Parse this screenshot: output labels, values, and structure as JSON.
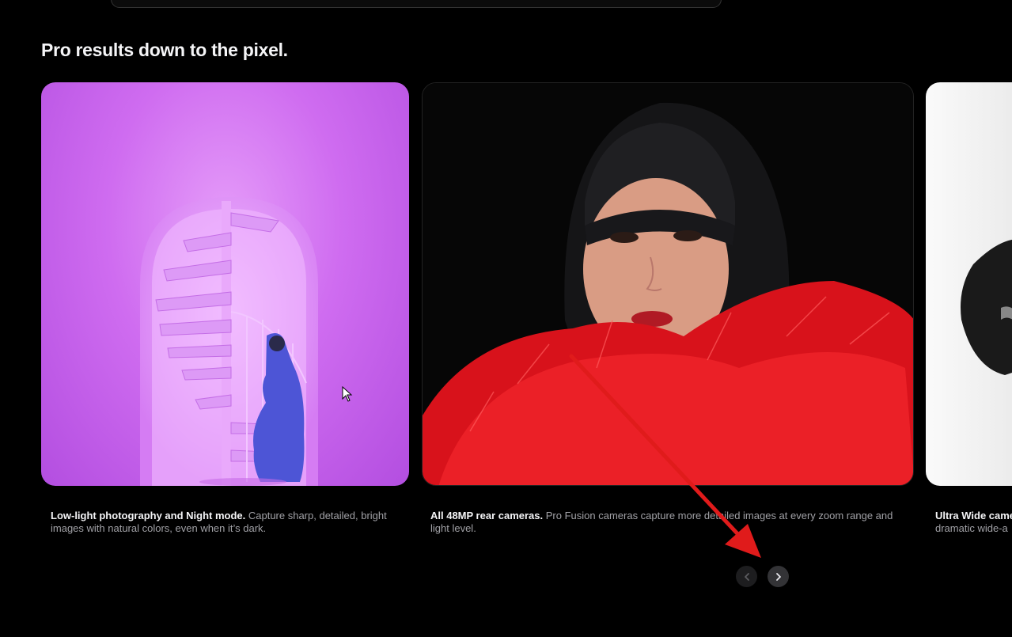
{
  "section": {
    "headline": "Pro results down to the pixel."
  },
  "cards": [
    {
      "title": "Low-light photography and Night mode.",
      "body": " Capture sharp, detailed, bright images with natural colors, even when it’s dark."
    },
    {
      "title": "All 48MP rear cameras.",
      "body": " Pro Fusion cameras capture more detailed images at every zoom range and light level."
    },
    {
      "title": "Ultra Wide came",
      "body": "dramatic wide-a"
    }
  ],
  "nav": {
    "prev_icon": "chevron-left-icon",
    "next_icon": "chevron-right-icon"
  },
  "colors": {
    "background": "#000000",
    "annotation_arrow": "#e01b1b",
    "card1_purple": "#cf6cf0",
    "fur_red": "#e3131b"
  }
}
